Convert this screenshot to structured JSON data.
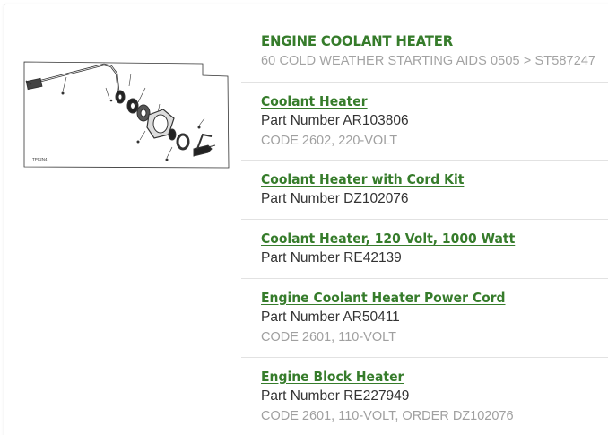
{
  "header": {
    "title": "ENGINE COOLANT HEATER",
    "breadcrumb": "60 COLD WEATHER STARTING AIDS 0505 > ST587247"
  },
  "diagram": {
    "code": "TP02N4"
  },
  "parts": [
    {
      "name": "Coolant Heater",
      "part_number": "Part Number AR103806",
      "code": "CODE 2602, 220-VOLT"
    },
    {
      "name": "Coolant Heater with Cord Kit",
      "part_number": "Part Number DZ102076",
      "code": ""
    },
    {
      "name": "Coolant Heater, 120 Volt, 1000 Watt",
      "part_number": "Part Number RE42139",
      "code": ""
    },
    {
      "name": "Engine Coolant Heater Power Cord",
      "part_number": "Part Number AR50411",
      "code": "CODE 2601, 110-VOLT"
    },
    {
      "name": "Engine Block Heater",
      "part_number": "Part Number RE227949",
      "code": "CODE 2601, 110-VOLT, ORDER DZ102076"
    }
  ],
  "colors": {
    "accent_green": "#367c2b",
    "muted_gray": "#a0a0a0"
  }
}
